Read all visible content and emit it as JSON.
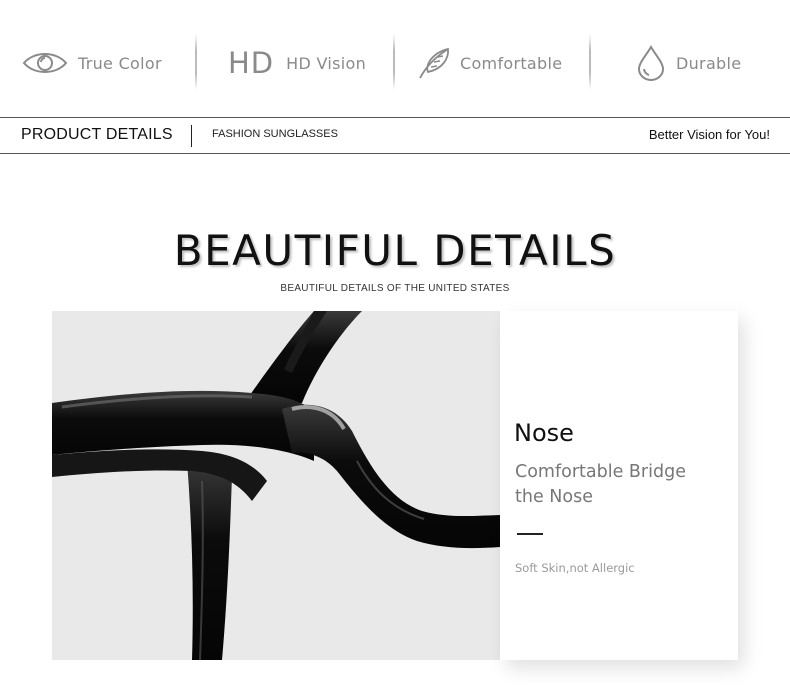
{
  "features": [
    {
      "icon": "eye-icon",
      "label": "True Color"
    },
    {
      "icon": "hd-icon",
      "mark": "HD",
      "label": "HD Vision"
    },
    {
      "icon": "feather-icon",
      "label": "Comfortable"
    },
    {
      "icon": "water-drop-icon",
      "label": "Durable"
    }
  ],
  "details_bar": {
    "title": "PRODUCT DETAILS",
    "subtitle": "FASHION SUNGLASSES",
    "slogan": "Better Vision for You!"
  },
  "headline": {
    "title": "BEAUTIFUL DETAILS",
    "subtitle": "BEAUTIFUL DETAILS OF THE UNITED STATES"
  },
  "detail": {
    "name": "Nose",
    "description_line1": "Comfortable Bridge",
    "description_line2": "the Nose",
    "note": "Soft Skin,not Allergic"
  },
  "colors": {
    "frame": "#0c0c0c",
    "photo_bg": "#e9e9e9",
    "muted_text": "#8a8a8a"
  }
}
